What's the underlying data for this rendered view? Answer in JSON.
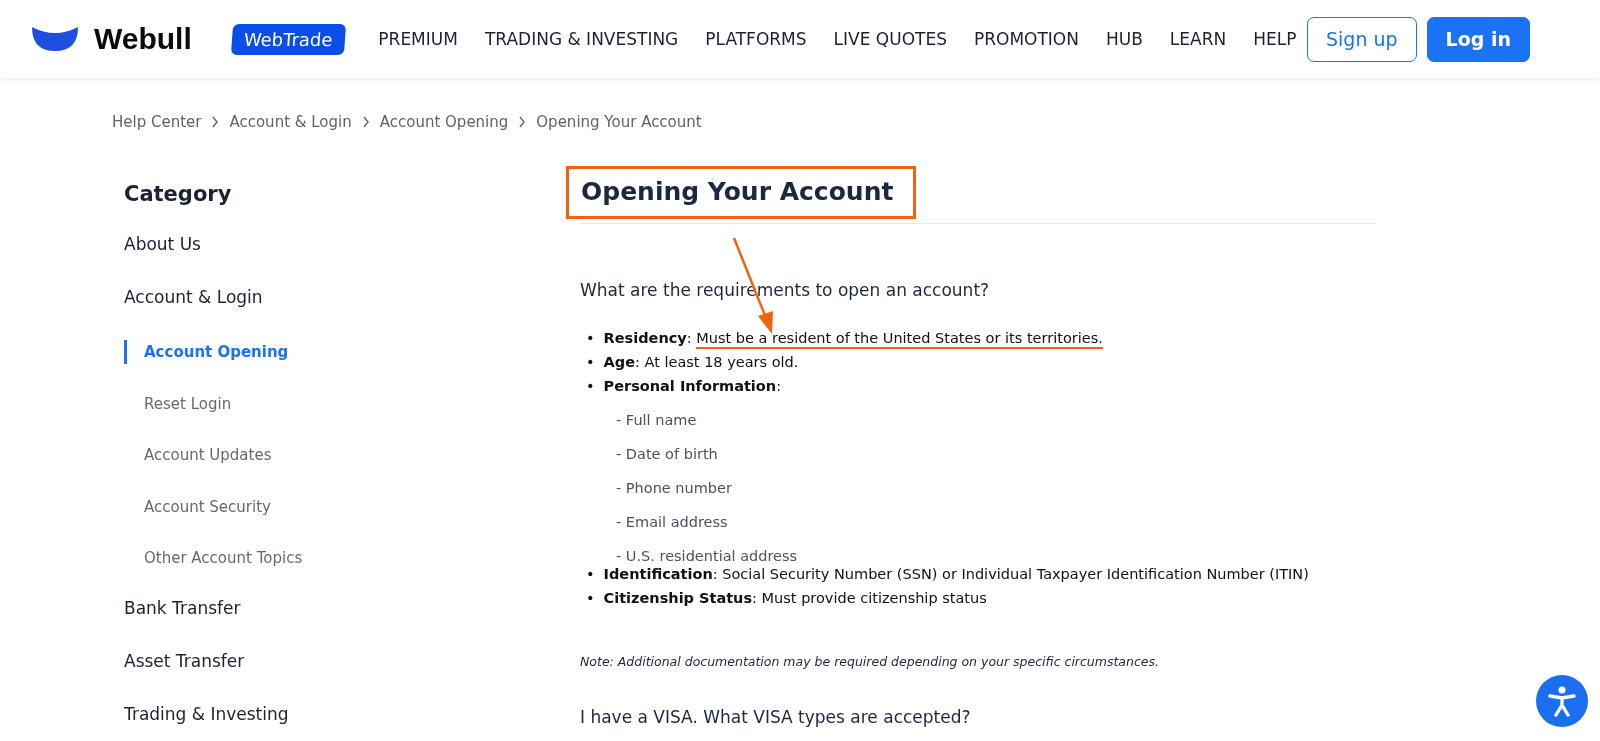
{
  "header": {
    "logo_text": "Webull",
    "badge": "WebTrade",
    "nav": [
      "PREMIUM",
      "TRADING & INVESTING",
      "PLATFORMS",
      "LIVE QUOTES",
      "PROMOTION",
      "HUB",
      "LEARN",
      "HELP"
    ],
    "buttons": [
      {
        "label": "Sign up",
        "kind": "outline"
      },
      {
        "label": "Log in",
        "kind": "primary"
      }
    ]
  },
  "breadcrumb": [
    "Help Center",
    "Account & Login",
    "Account Opening",
    "Opening Your Account"
  ],
  "sidebar": {
    "title": "Category",
    "items": [
      {
        "label": "About Us",
        "selected": false
      },
      {
        "label": "Account & Login",
        "selected": false,
        "children": [
          {
            "label": "Account Opening",
            "selected": true
          },
          {
            "label": "Reset Login",
            "selected": false
          },
          {
            "label": "Account Updates",
            "selected": false
          },
          {
            "label": "Account Security",
            "selected": false
          },
          {
            "label": "Other Account Topics",
            "selected": false
          }
        ]
      },
      {
        "label": "Bank Transfer",
        "selected": false
      },
      {
        "label": "Asset Transfer",
        "selected": false
      },
      {
        "label": "Trading & Investing",
        "selected": false
      }
    ]
  },
  "article": {
    "title": "Opening Your Account",
    "highlighted": true,
    "question": "What are the requirements to open an account?",
    "requirements": [
      {
        "marker": "•",
        "term": "**Residency**:",
        "text": "Must be a resident of the United States or its territories.",
        "underlined": true
      },
      {
        "marker": "•",
        "term": "**Age**:",
        "text": "At least 18 years old.",
        "underlined": false
      },
      {
        "marker": "•",
        "term": "**Personal Information**:",
        "underlined": false,
        "children": [
          "- Full name",
          "- Date of birth",
          "- Phone number",
          "- Email address",
          "- U.S. residential address"
        ]
      },
      {
        "marker": "•",
        "term": "**Identification**:",
        "text": "Social Security Number (SSN) or Individual Taxpayer Identification Number (ITIN)",
        "underlined": false
      },
      {
        "marker": "•",
        "term": "**Citizenship Status**:",
        "text": "Must provide citizenship status",
        "underlined": false
      }
    ],
    "note": "Note: Additional documentation may be required depending on your specific circumstances.",
    "next_question": "I have a VISA. What VISA types are accepted?"
  }
}
